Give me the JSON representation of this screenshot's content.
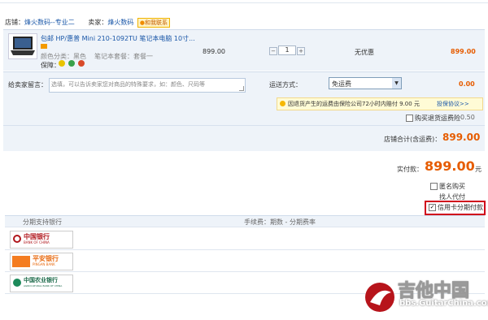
{
  "store": {
    "label": "店铺：",
    "name": "烽火数码--专业二",
    "seller_label": "卖家：",
    "seller_name": "烽火数码",
    "contact_label": "和我联系"
  },
  "item": {
    "title": "包邮 HP/惠普 Mini 210-1092TU 笔记本电脑 10寸...",
    "color_label": "颜色分类：黑色",
    "package_label": "笔记本套餐：套餐一",
    "guarantee_label": "保障：",
    "unit_price": "899.00",
    "quantity": "1",
    "discount": "无优惠",
    "subtotal": "899.00"
  },
  "message": {
    "label": "给卖家留言：",
    "placeholder": "选填，可以告诉卖家您对商品的特殊要求，如：颜色、尺码等"
  },
  "shipping": {
    "label": "运送方式：",
    "selected": "免运费",
    "fee": "0.00",
    "insurance_note": "因退货产生的运费由保险公司72小时内赔付 9.00 元",
    "insurance_link": "投保协议>>",
    "insurance_checkbox_label": "购买退货运费险",
    "insurance_fee": "0.50"
  },
  "store_total": {
    "label": "店铺合计(含运费)：",
    "value": "899.00"
  },
  "payment": {
    "label": "实付款：",
    "value": "899.00",
    "unit": "元",
    "anonymous": "匿名购买",
    "proxy_pay": "找人代付",
    "installment": "信用卡分期付款"
  },
  "installment_table": {
    "header_bank": "分期支持银行",
    "header_fee": "手续费：期数 - 分期费率",
    "banks": [
      {
        "cn": "中国银行",
        "en": "BANK OF CHINA"
      },
      {
        "cn": "平安银行",
        "en": "PINGAN BANK"
      },
      {
        "cn": "中国农业银行",
        "en": "AGRICULTURAL BANK OF CHINA"
      }
    ]
  },
  "watermark": {
    "cn": "吉他中国",
    "url": "bbs.GuitarChina.com"
  },
  "colors": {
    "accent_orange": "#e65c00",
    "link_blue": "#1a57a8",
    "highlight_red": "#d0021b",
    "panel_blue": "#eef3f9"
  }
}
